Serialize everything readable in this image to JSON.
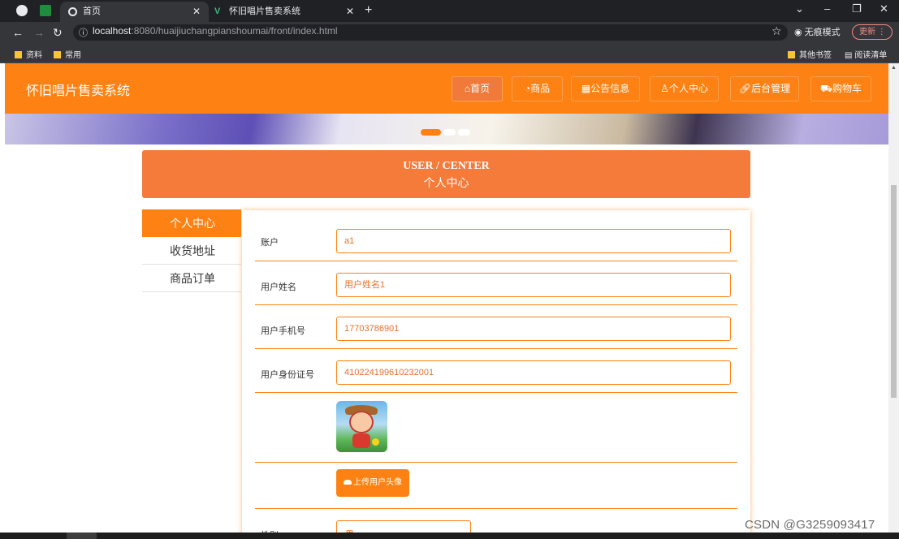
{
  "browser": {
    "tabs": [
      {
        "title": "首页",
        "active": true
      },
      {
        "title": "怀旧唱片售卖系统",
        "active": false
      }
    ],
    "url_host": "localhost",
    "url_rest": ":8080/huaijiuchangpianshoumai/front/index.html",
    "incognito_label": "无痕模式",
    "update_label": "更新",
    "bookmarks": [
      "资料",
      "常用"
    ],
    "bookmarks_right": [
      "其他书签",
      "阅读清单"
    ]
  },
  "header": {
    "site_title": "怀旧唱片售卖系统",
    "nav": [
      "首页",
      "商品",
      "公告信息",
      "个人中心",
      "后台管理",
      "购物车"
    ],
    "accent": "#fe8213"
  },
  "center": {
    "title_en": "USER / CENTER",
    "title_zh": "个人中心"
  },
  "sidebar": {
    "items": [
      {
        "label": "个人中心",
        "active": true
      },
      {
        "label": "收货地址",
        "active": false
      },
      {
        "label": "商品订单",
        "active": false
      }
    ]
  },
  "form": {
    "account_label": "账户",
    "account_value": "a1",
    "name_label": "用户姓名",
    "name_value": "用户姓名1",
    "phone_label": "用户手机号",
    "phone_value": "17703786901",
    "id_label": "用户身份证号",
    "id_value": "410224199610232001",
    "upload_label": "上传用户头像",
    "gender_label": "性别",
    "gender_value": "男"
  },
  "watermark": "CSDN @G3259093417"
}
